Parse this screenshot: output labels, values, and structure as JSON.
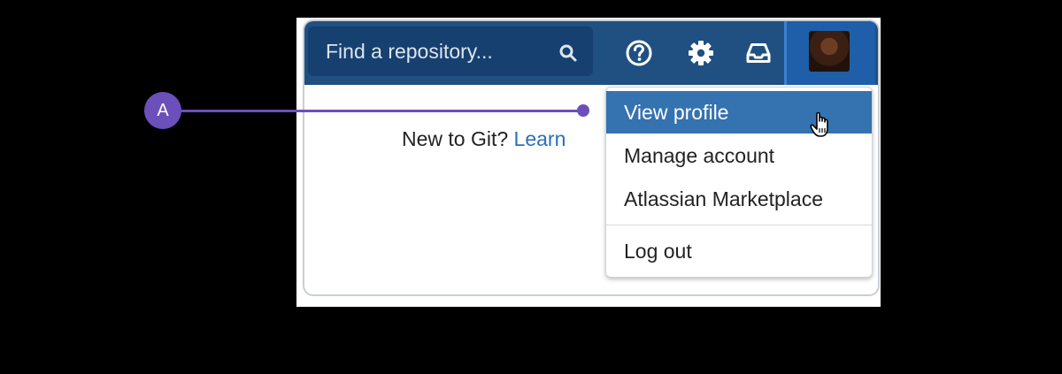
{
  "header": {
    "search": {
      "placeholder": "Find a repository..."
    },
    "icons": [
      "help-icon",
      "gear-icon",
      "inbox-icon"
    ],
    "avatar": "user-avatar"
  },
  "content": {
    "prompt": "New to Git?",
    "link": "Learn"
  },
  "dropdown": {
    "items": [
      {
        "label": "View profile",
        "active": true
      },
      {
        "label": "Manage account"
      },
      {
        "label": "Atlassian Marketplace"
      },
      {
        "label": "Log out"
      }
    ]
  },
  "callout": {
    "label": "A"
  },
  "colors": {
    "header": "#205081",
    "search_bg": "#164070",
    "active_item": "#3572b0",
    "link": "#2a6fb9",
    "callout": "#6b4fbb"
  }
}
